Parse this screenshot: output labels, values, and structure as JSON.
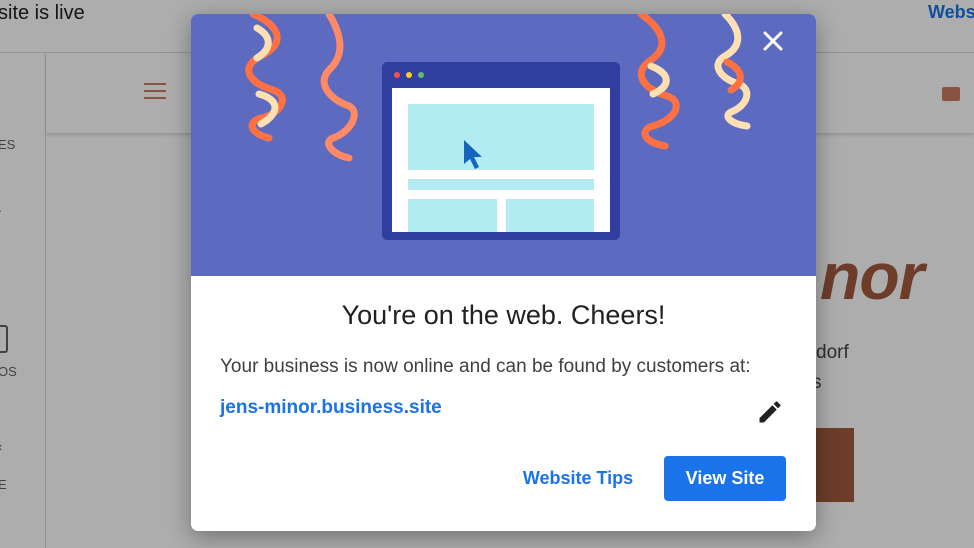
{
  "background": {
    "topbar": {
      "status_text": "site is live",
      "link_text": "Webs"
    },
    "leftnav": {
      "items": [
        "ES",
        "·",
        "OS",
        "‹",
        "E"
      ]
    },
    "site": {
      "title": "nor",
      "subtitle_line1": "dorf",
      "subtitle_line2": "s"
    }
  },
  "dialog": {
    "title": "You're on the web. Cheers!",
    "body": "Your business is now online and can be found by customers at:",
    "site_url": "jens-minor.business.site",
    "buttons": {
      "tips_label": "Website Tips",
      "view_label": "View Site"
    },
    "icons": {
      "close": "close-icon",
      "edit": "pencil-icon",
      "cursor": "cursor-icon"
    }
  },
  "colors": {
    "hero_bg": "#5c6bc0",
    "primary": "#1a73e8",
    "site_accent": "#a35a3f",
    "browser_frame": "#303f9f",
    "browser_content": "#b2ebf2"
  }
}
